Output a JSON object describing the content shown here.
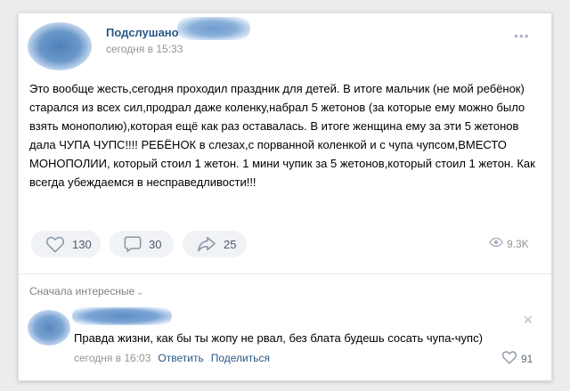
{
  "post": {
    "group_name": "Подслушано",
    "time": "сегодня в 15:33",
    "more_icon": "more-icon",
    "text": "Это вообще жесть,сегодня проходил праздник для детей. В итоге мальчик (не мой ребёнок) старался из всех сил,продрал даже коленку,набрал 5 жетонов (за которые ему можно было взять монополию),которая ещё как раз оставалась. В итоге женщина ему за эти 5 жетонов дала ЧУПА ЧУПС!!!! РЕБЁНОК в слезах,с порванной коленкой и с чупа чупсом,ВМЕСТО МОНОПОЛИИ, который стоил 1 жетон. 1 мини чупик за 5 жетонов,который стоил 1 жетон. Как всегда убеждаемся в несправедливости!!!"
  },
  "actions": {
    "likes": "130",
    "comments": "30",
    "shares": "25",
    "views": "9.3K"
  },
  "comments_section": {
    "sort_label": "Сначала интересные",
    "comment": {
      "text": "Правда жизни, как бы ты жопу не рвал, без блата будешь сосать чупа-чупс)",
      "time": "сегодня в 16:03",
      "reply_label": "Ответить",
      "share_label": "Поделиться",
      "likes": "91"
    }
  },
  "colors": {
    "link_blue": "#2a5885",
    "muted_gray": "#939393",
    "button_bg": "#f0f2f5"
  }
}
